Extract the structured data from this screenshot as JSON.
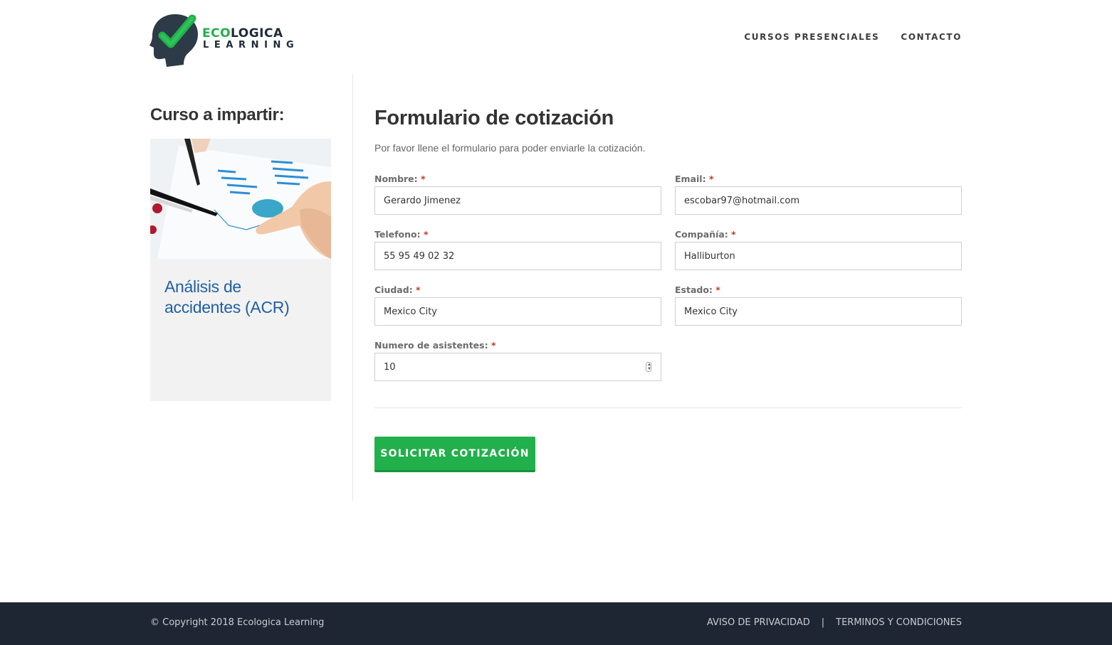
{
  "brand": {
    "name_highlight": "ECO",
    "name_rest": "LOGICA",
    "tagline": "LEARNING",
    "colors": {
      "green": "#21b04b",
      "navy": "#1f2a36"
    }
  },
  "nav": {
    "items": [
      {
        "label": "CURSOS PRESENCIALES"
      },
      {
        "label": "CONTACTO"
      }
    ]
  },
  "sidebar": {
    "title": "Curso a impartir:",
    "course_name": "Análisis de accidentes (ACR)"
  },
  "form": {
    "title": "Formulario de cotización",
    "subtitle": "Por favor llene el formulario para poder enviarle la cotización.",
    "required_mark": "*",
    "fields": {
      "nombre": {
        "label": "Nombre:",
        "value": "Gerardo Jimenez"
      },
      "email": {
        "label": "Email:",
        "value": "escobar97@hotmail.com"
      },
      "telefono": {
        "label": "Telefono:",
        "value": "55 95 49 02 32"
      },
      "compania": {
        "label": "Compañía:",
        "value": "Halliburton"
      },
      "ciudad": {
        "label": "Ciudad:",
        "value": "Mexico City"
      },
      "estado": {
        "label": "Estado:",
        "value": "Mexico City"
      },
      "asistentes": {
        "label": "Numero de asistentes:",
        "value": "10"
      }
    },
    "submit_label": "SOLICITAR COTIZACIÓN"
  },
  "footer": {
    "copyright": "© Copyright 2018 Ecologica Learning",
    "links": [
      {
        "label": "AVISO DE PRIVACIDAD"
      },
      {
        "label": "TERMINOS Y CONDICIONES"
      }
    ],
    "separator": "|"
  }
}
